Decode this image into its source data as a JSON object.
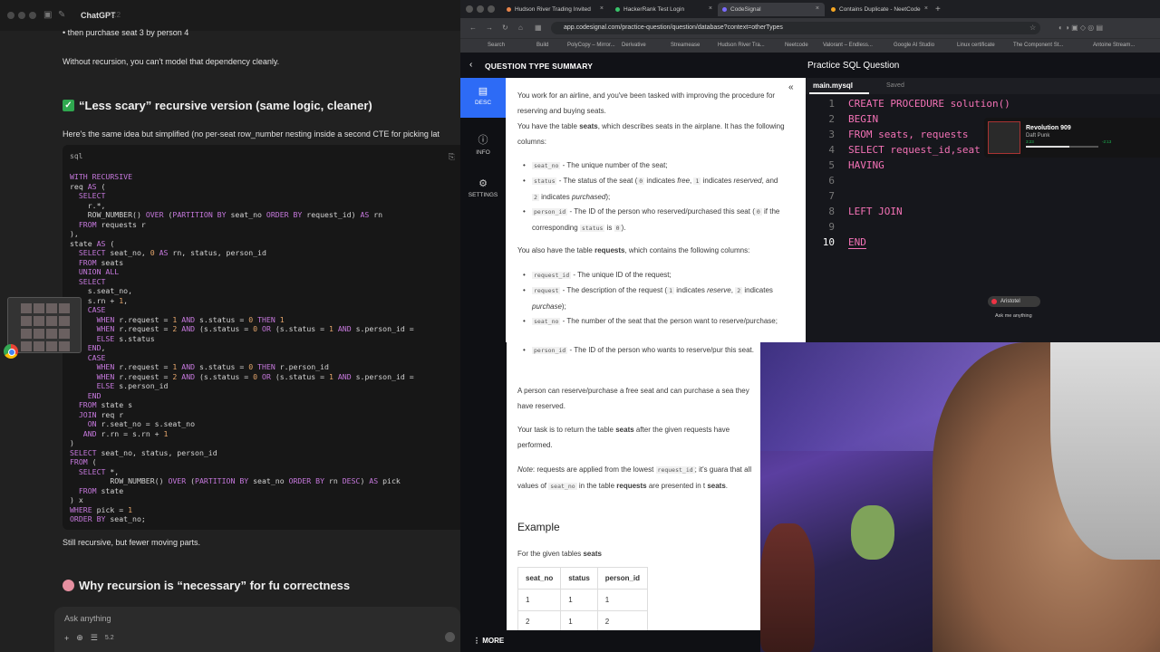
{
  "chat": {
    "title": "ChatGPT",
    "title_sub": "5.2",
    "line_seat": "• then purchase seat 3 by person 4",
    "line_without": "Without recursion, you can't model that dependency cleanly.",
    "heading_less_scary": "“Less scary” recursive version (same logic, cleaner)",
    "intro": "Here's the same idea but simplified (no per-seat row_number nesting inside a second CTE for picking lat",
    "code_lang": "sql",
    "closing": "Still recursive, but fewer moving parts.",
    "heading_why": "Why recursion is “necessary” for fu  correctness",
    "ask_placeholder": "Ask anything",
    "ask_version": "5.2"
  },
  "browser": {
    "tabs": [
      {
        "label": "Hudson River Trading Invited",
        "color": "#e8844a"
      },
      {
        "label": "HackerRank Test Login",
        "color": "#39c46b"
      },
      {
        "label": "CodeSignal",
        "color": "#7b6bff"
      },
      {
        "label": "Contains Duplicate - NeetCode",
        "color": "#f5a623"
      }
    ],
    "url": "app.codesignal.com/practice-question/question/database?context=otherTypes",
    "bookmarks": [
      "Search",
      "Build",
      "PolyCopy – Mirror...",
      "Derivative",
      "Streamease",
      "Hudson River Tra...",
      "Neetcode",
      "Valorant – Endless...",
      "Google AI Studio",
      "Linux certificate",
      "The Component St...",
      "Antoine Stream..."
    ]
  },
  "codesignal": {
    "question_type_summary": "QUESTION TYPE SUMMARY",
    "practice_title": "Practice SQL Question",
    "side": [
      {
        "label": "DESC",
        "icon": "doc-icon"
      },
      {
        "label": "INFO",
        "icon": "info-icon"
      },
      {
        "label": "SETTINGS",
        "icon": "gear-icon"
      }
    ],
    "editor_tab": "main.mysql",
    "editor_saved": "Saved",
    "code_lines": [
      {
        "n": "1",
        "text": "CREATE PROCEDURE solution()"
      },
      {
        "n": "2",
        "text": "BEGIN"
      },
      {
        "n": "3",
        "text": "FROM seats, requests"
      },
      {
        "n": "4",
        "text": "SELECT request_id,seat"
      },
      {
        "n": "5",
        "text": "HAVING"
      },
      {
        "n": "6",
        "text": ""
      },
      {
        "n": "7",
        "text": ""
      },
      {
        "n": "8",
        "text": "LEFT JOIN"
      },
      {
        "n": "9",
        "text": ""
      },
      {
        "n": "10",
        "text": "END"
      }
    ],
    "more": "MORE",
    "example_heading": "Example",
    "example_intro_a": "For the given tables ",
    "example_intro_b": "seats",
    "table_headers": [
      "seat_no",
      "status",
      "person_id"
    ],
    "table_rows": [
      [
        "1",
        "1",
        "1"
      ],
      [
        "2",
        "1",
        "2"
      ]
    ]
  },
  "spotify": {
    "title": "Revolution 909",
    "artist": "Daft Punk",
    "elapsed": "3:23",
    "remaining": "-2:13",
    "progress": 0.6
  },
  "assistant_widget": {
    "name": "Aristotel",
    "ask": "Ask me anything"
  }
}
